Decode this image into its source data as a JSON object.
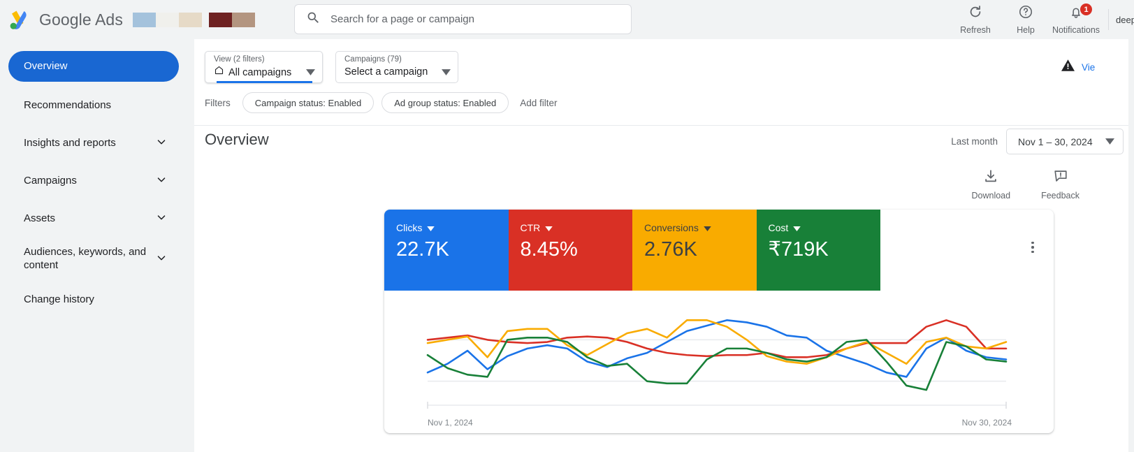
{
  "topbar": {
    "brand": "Google Ads",
    "logo_icon": "google-ads-logo",
    "swatches": [
      {
        "name": "swatch-blue",
        "color": "#a4c2dc"
      },
      {
        "name": "swatch-offwhite",
        "color": "#f0f0ec"
      },
      {
        "name": "swatch-tan",
        "color": "#e6dac7"
      },
      {
        "name": "swatch-maroon",
        "color": "#6e2222"
      },
      {
        "name": "swatch-brown",
        "color": "#b39580"
      }
    ],
    "search": {
      "icon": "search-icon",
      "placeholder": "Search for a page or campaign",
      "value": ""
    },
    "actions": [
      {
        "label": "Refresh",
        "icon": "refresh-icon"
      },
      {
        "label": "Help",
        "icon": "help-circle-icon"
      },
      {
        "label": "Notifications",
        "icon": "bell-icon",
        "badge": "1"
      }
    ],
    "account": "deep"
  },
  "sidebar": {
    "items": [
      {
        "label": "Overview",
        "active": true,
        "expandable": false
      },
      {
        "label": "Recommendations",
        "active": false,
        "expandable": false
      },
      {
        "label": "Insights and reports",
        "active": false,
        "expandable": true
      },
      {
        "label": "Campaigns",
        "active": false,
        "expandable": true
      },
      {
        "label": "Assets",
        "active": false,
        "expandable": true
      },
      {
        "label": "Audiences, keywords, and content",
        "active": false,
        "expandable": true
      },
      {
        "label": "Change history",
        "active": false,
        "expandable": false
      }
    ]
  },
  "selectors": {
    "view": {
      "caption": "View (2 filters)",
      "value": "All campaigns",
      "icon": "home-icon"
    },
    "campaigns": {
      "caption": "Campaigns (79)",
      "value": "Select a campaign"
    }
  },
  "filters": {
    "label": "Filters",
    "chips": [
      "Campaign status: Enabled",
      "Ad group status: Enabled"
    ],
    "add_label": "Add filter"
  },
  "warning": {
    "icon": "warning-triangle-icon",
    "text": "Vie"
  },
  "page": {
    "title": "Overview"
  },
  "date_range": {
    "prefix": "Last month",
    "value": "Nov 1 – 30, 2024",
    "caret_icon": "chevron-down-icon",
    "prev_icon": "chevron-left-icon"
  },
  "tools": [
    {
      "label": "Download",
      "icon": "download-icon"
    },
    {
      "label": "Feedback",
      "icon": "feedback-icon"
    }
  ],
  "card": {
    "kebab_icon": "more-vert-icon",
    "metrics": [
      {
        "label": "Clicks",
        "value": "22.7K",
        "bg": "#1a73e8",
        "fg": "#ffffff",
        "caret_icon": "chevron-down-icon"
      },
      {
        "label": "CTR",
        "value": "8.45%",
        "bg": "#d93025",
        "fg": "#ffffff",
        "caret_icon": "chevron-down-icon"
      },
      {
        "label": "Conversions",
        "value": "2.76K",
        "bg": "#f9ab00",
        "fg": "#3c4043",
        "caret_icon": "chevron-down-icon"
      },
      {
        "label": "Cost",
        "value": "₹719K",
        "bg": "#188038",
        "fg": "#ffffff",
        "caret_icon": "chevron-down-icon"
      }
    ]
  },
  "chart_data": {
    "type": "line",
    "title": "",
    "xlabel": "",
    "ylabel": "",
    "grid": true,
    "legend": "none",
    "x_axis_start_label": "Nov 1, 2024",
    "x_axis_end_label": "Nov 30, 2024",
    "x": [
      1,
      2,
      3,
      4,
      5,
      6,
      7,
      8,
      9,
      10,
      11,
      12,
      13,
      14,
      15,
      16,
      17,
      18,
      19,
      20,
      21,
      22,
      23,
      24,
      25,
      26,
      27,
      28,
      29,
      30
    ],
    "ylim": [
      0,
      100
    ],
    "series": [
      {
        "name": "Clicks",
        "color": "#1a73e8",
        "values": [
          30,
          38,
          50,
          33,
          45,
          52,
          55,
          52,
          40,
          35,
          43,
          48,
          58,
          68,
          73,
          78,
          76,
          72,
          64,
          62,
          50,
          44,
          38,
          30,
          26,
          52,
          62,
          50,
          44,
          42
        ]
      },
      {
        "name": "CTR",
        "color": "#d93025",
        "values": [
          60,
          62,
          64,
          60,
          58,
          57,
          58,
          62,
          63,
          62,
          58,
          52,
          48,
          46,
          45,
          46,
          46,
          48,
          44,
          44,
          46,
          52,
          57,
          57,
          57,
          72,
          78,
          72,
          52,
          52
        ]
      },
      {
        "name": "Conversions",
        "color": "#f9ab00",
        "values": [
          57,
          60,
          63,
          44,
          68,
          70,
          70,
          55,
          46,
          56,
          66,
          70,
          62,
          78,
          78,
          72,
          60,
          45,
          40,
          38,
          44,
          52,
          58,
          48,
          38,
          58,
          62,
          54,
          52,
          58
        ]
      },
      {
        "name": "Cost",
        "color": "#188038",
        "values": [
          46,
          34,
          28,
          26,
          60,
          62,
          62,
          58,
          44,
          36,
          38,
          22,
          20,
          20,
          42,
          52,
          52,
          48,
          42,
          40,
          44,
          58,
          60,
          40,
          18,
          14,
          58,
          54,
          42,
          40
        ]
      }
    ]
  }
}
